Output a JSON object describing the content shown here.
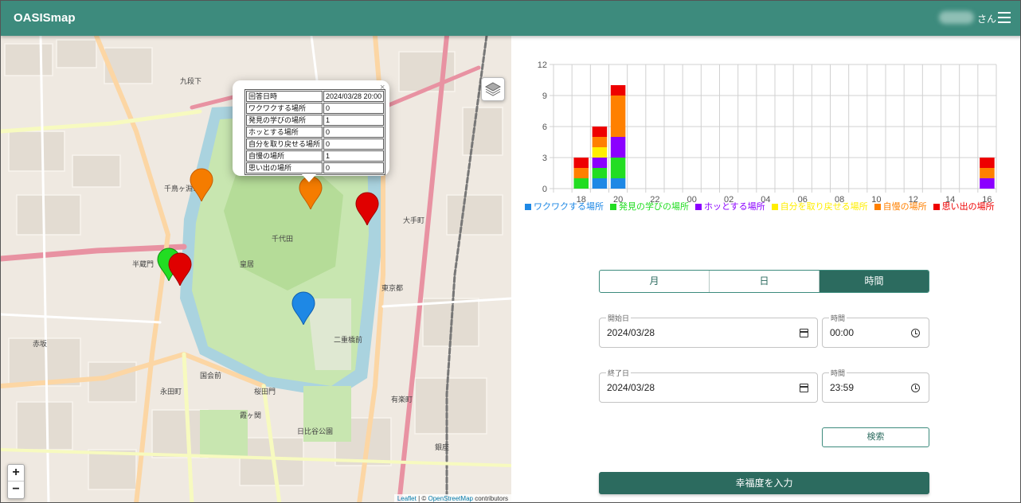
{
  "app": {
    "title": "OASISmap",
    "user_suffix": "さん",
    "menu_icon": "menu-icon"
  },
  "map": {
    "attribution": {
      "leaflet": "Leaflet",
      "sep": " | © ",
      "osm": "OpenStreetMap",
      "rest": " contributors"
    },
    "zoom_in": "+",
    "zoom_out": "−",
    "place_labels": [
      "皇居",
      "東京都",
      "千代田",
      "大手町",
      "日比谷公園",
      "国会前",
      "千鳥ヶ淵公園",
      "桜田門",
      "二重橋前",
      "有楽町",
      "銀座",
      "九段下",
      "半蔵門",
      "永田町",
      "赤坂",
      "霞ヶ関"
    ],
    "markers": [
      {
        "color": "#f57c00"
      },
      {
        "color": "#f57c00"
      },
      {
        "color": "#e00000"
      },
      {
        "color": "#22dd22"
      },
      {
        "color": "#e00000"
      },
      {
        "color": "#1e88e5"
      }
    ],
    "popup": {
      "rows": [
        {
          "key": "回答日時",
          "value": "2024/03/28 20:00"
        },
        {
          "key": "ワクワクする場所",
          "value": "0"
        },
        {
          "key": "発見の学びの場所",
          "value": "1"
        },
        {
          "key": "ホッとする場所",
          "value": "0"
        },
        {
          "key": "自分を取り戻せる場所",
          "value": "0"
        },
        {
          "key": "自慢の場所",
          "value": "1"
        },
        {
          "key": "思い出の場所",
          "value": "0"
        }
      ],
      "close": "×"
    }
  },
  "chart_data": {
    "type": "bar",
    "stacked": true,
    "categories": [
      "17",
      "18",
      "19",
      "20",
      "21",
      "22",
      "23",
      "00",
      "01",
      "02",
      "03",
      "04",
      "05",
      "06",
      "07",
      "08",
      "09",
      "10",
      "11",
      "12",
      "13",
      "14",
      "15",
      "16"
    ],
    "x_tick_labels": [
      "18",
      "20",
      "22",
      "00",
      "02",
      "04",
      "06",
      "08",
      "10",
      "12",
      "14",
      "16"
    ],
    "ylim": [
      0,
      12
    ],
    "y_ticks": [
      0,
      3,
      6,
      9,
      12
    ],
    "grid": true,
    "legend_position": "bottom",
    "series": [
      {
        "name": "ワクワクする場所",
        "color": "#1e88e5",
        "values": [
          0,
          0,
          1,
          1,
          0,
          0,
          0,
          0,
          0,
          0,
          0,
          0,
          0,
          0,
          0,
          0,
          0,
          0,
          0,
          0,
          0,
          0,
          0,
          0
        ]
      },
      {
        "name": "発見の学びの場所",
        "color": "#22dd22",
        "values": [
          0,
          1,
          1,
          2,
          0,
          0,
          0,
          0,
          0,
          0,
          0,
          0,
          0,
          0,
          0,
          0,
          0,
          0,
          0,
          0,
          0,
          0,
          0,
          0
        ]
      },
      {
        "name": "ホッとする場所",
        "color": "#8b00ff",
        "values": [
          0,
          0,
          1,
          2,
          0,
          0,
          0,
          0,
          0,
          0,
          0,
          0,
          0,
          0,
          0,
          0,
          0,
          0,
          0,
          0,
          0,
          0,
          0,
          1
        ]
      },
      {
        "name": "自分を取り戻せる場所",
        "color": "#ffee00",
        "values": [
          0,
          0,
          1,
          0,
          0,
          0,
          0,
          0,
          0,
          0,
          0,
          0,
          0,
          0,
          0,
          0,
          0,
          0,
          0,
          0,
          0,
          0,
          0,
          0
        ]
      },
      {
        "name": "自慢の場所",
        "color": "#ff8000",
        "values": [
          0,
          1,
          1,
          4,
          0,
          0,
          0,
          0,
          0,
          0,
          0,
          0,
          0,
          0,
          0,
          0,
          0,
          0,
          0,
          0,
          0,
          0,
          0,
          1
        ]
      },
      {
        "name": "思い出の場所",
        "color": "#ee0000",
        "values": [
          0,
          1,
          1,
          1,
          0,
          0,
          0,
          0,
          0,
          0,
          0,
          0,
          0,
          0,
          0,
          0,
          0,
          0,
          0,
          0,
          0,
          0,
          0,
          1
        ]
      }
    ]
  },
  "controls": {
    "segments": [
      {
        "label": "月",
        "active": false
      },
      {
        "label": "日",
        "active": false
      },
      {
        "label": "時間",
        "active": true
      }
    ],
    "start_date": {
      "label": "開始日",
      "value": "2024/03/28"
    },
    "start_time": {
      "label": "時間",
      "value": "00:00"
    },
    "end_date": {
      "label": "終了日",
      "value": "2024/03/28"
    },
    "end_time": {
      "label": "時間",
      "value": "23:59"
    },
    "search_label": "検索",
    "submit_label": "幸福度を入力"
  }
}
